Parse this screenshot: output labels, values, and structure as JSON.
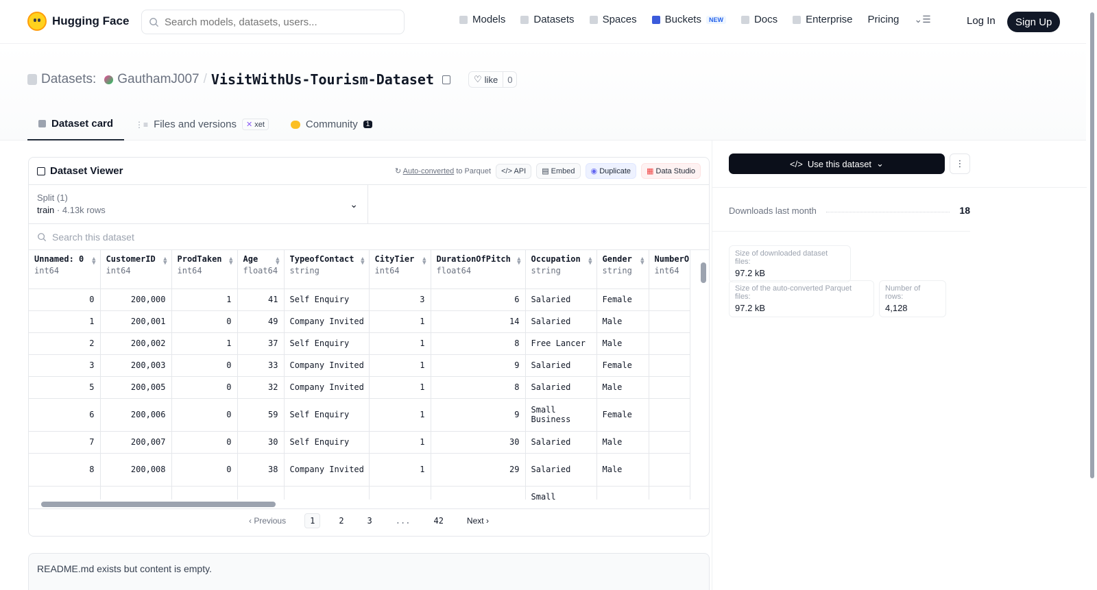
{
  "nav": {
    "brand": "Hugging Face",
    "search_placeholder": "Search models, datasets, users...",
    "links": [
      "Models",
      "Datasets",
      "Spaces",
      "Buckets",
      "Docs",
      "Enterprise",
      "Pricing"
    ],
    "new_badge": "NEW",
    "login": "Log In",
    "signup": "Sign Up"
  },
  "header": {
    "section": "Datasets:",
    "owner": "GauthamJ007",
    "name": "VisitWithUs-Tourism-Dataset",
    "like_label": "like",
    "like_count": "0",
    "tabs": {
      "card": "Dataset card",
      "files": "Files and versions",
      "xet": "xet",
      "community": "Community",
      "community_count": "1"
    }
  },
  "viewer": {
    "title": "Dataset Viewer",
    "auto_link": "Auto-converted",
    "auto_rest": "to Parquet",
    "api": "API",
    "embed": "Embed",
    "duplicate": "Duplicate",
    "studio": "Data Studio",
    "split_label": "Split (1)",
    "split_name": "train",
    "split_rows": "4.13k rows",
    "search_placeholder": "Search this dataset",
    "columns": [
      {
        "name": "Unnamed: 0",
        "type": "int64"
      },
      {
        "name": "CustomerID",
        "type": "int64"
      },
      {
        "name": "ProdTaken",
        "type": "int64"
      },
      {
        "name": "Age",
        "type": "float64"
      },
      {
        "name": "TypeofContact",
        "type": "string"
      },
      {
        "name": "CityTier",
        "type": "int64"
      },
      {
        "name": "DurationOfPitch",
        "type": "float64"
      },
      {
        "name": "Occupation",
        "type": "string"
      },
      {
        "name": "Gender",
        "type": "string"
      },
      {
        "name": "NumberO",
        "type": "int64"
      }
    ],
    "rows": [
      [
        "0",
        "200,000",
        "1",
        "41",
        "Self Enquiry",
        "3",
        "6",
        "Salaried",
        "Female",
        ""
      ],
      [
        "1",
        "200,001",
        "0",
        "49",
        "Company Invited",
        "1",
        "14",
        "Salaried",
        "Male",
        ""
      ],
      [
        "2",
        "200,002",
        "1",
        "37",
        "Self Enquiry",
        "1",
        "8",
        "Free Lancer",
        "Male",
        ""
      ],
      [
        "3",
        "200,003",
        "0",
        "33",
        "Company Invited",
        "1",
        "9",
        "Salaried",
        "Female",
        ""
      ],
      [
        "5",
        "200,005",
        "0",
        "32",
        "Company Invited",
        "1",
        "8",
        "Salaried",
        "Male",
        ""
      ],
      [
        "6",
        "200,006",
        "0",
        "59",
        "Self Enquiry",
        "1",
        "9",
        "Small Business",
        "Female",
        ""
      ],
      [
        "7",
        "200,007",
        "0",
        "30",
        "Self Enquiry",
        "1",
        "30",
        "Salaried",
        "Male",
        ""
      ],
      [
        "8",
        "200,008",
        "0",
        "38",
        "Company Invited",
        "1",
        "29",
        "Salaried",
        "Male",
        ""
      ],
      [
        "",
        "",
        "",
        "",
        "",
        "",
        "",
        "Small",
        "",
        ""
      ]
    ],
    "pager": {
      "prev": "Previous",
      "pages": [
        "1",
        "2",
        "3",
        "...",
        "42"
      ],
      "next": "Next"
    }
  },
  "readme": "README.md exists but content is empty.",
  "sidebar": {
    "use_btn": "Use this dataset",
    "downloads_label": "Downloads last month",
    "downloads": "18",
    "size_dl_label": "Size of downloaded dataset files:",
    "size_dl": "97.2 kB",
    "size_pq_label": "Size of the auto-converted Parquet files:",
    "size_pq": "97.2 kB",
    "rows_label": "Number of rows:",
    "rows": "4,128"
  }
}
